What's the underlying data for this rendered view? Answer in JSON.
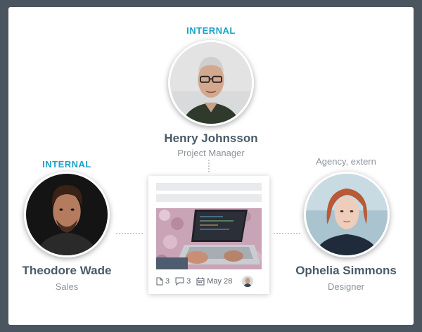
{
  "top_person": {
    "tag": "INTERNAL",
    "name": "Henry Johnsson",
    "role": "Project Manager"
  },
  "left_person": {
    "tag": "INTERNAL",
    "name": "Theodore Wade",
    "role": "Sales"
  },
  "right_person": {
    "tag": "Agency, extern",
    "name": "Ophelia Simmons",
    "role": "Designer"
  },
  "task_card": {
    "files_count": "3",
    "comments_count": "3",
    "due_date": "May 28"
  },
  "colors": {
    "accent": "#1aa3c9",
    "name_text": "#4a5a68",
    "muted_text": "#8b949c",
    "frame_bg": "#4a5560"
  },
  "icons": [
    "file-icon",
    "comment-icon",
    "calendar-icon",
    "assignee-avatar"
  ]
}
